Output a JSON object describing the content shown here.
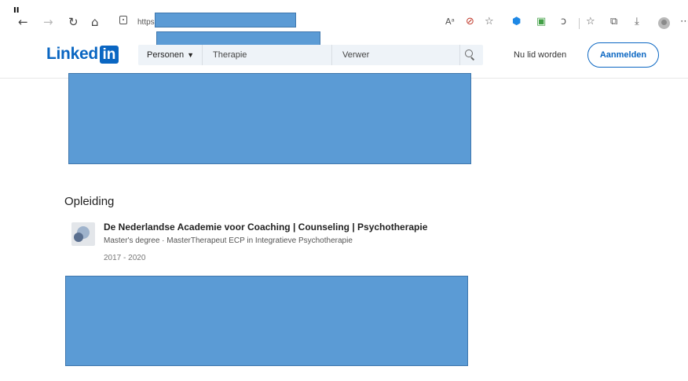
{
  "browser": {
    "pause_glyph": "II",
    "nav": {
      "back": "←",
      "forward": "→",
      "reload": "↻",
      "home": "⌂"
    },
    "url_prefix": "https:",
    "toolbar_icons": [
      "read-aloud-icon",
      "tracking-prevention-icon",
      "favorites-add-icon",
      "extension-shield-icon",
      "extension-monitor-icon",
      "copilot-icon",
      "favorites-icon",
      "collections-icon",
      "downloads-icon",
      "profile-icon",
      "more-icon"
    ],
    "toolbar_glyphs": {
      "read_aloud": "Aᵃ",
      "tracking": "⊘",
      "fav_add": "☆",
      "ext_shield": "⬢",
      "ext_monitor": "▣",
      "copilot": "ↄ",
      "favorites": "☆",
      "collections": "⧉",
      "downloads": "⤓",
      "more": "⋯"
    },
    "colors": {
      "redaction": "#5b9bd5"
    }
  },
  "linkedin": {
    "logo": {
      "word": "Linked",
      "box": "in"
    },
    "search": {
      "category": "Personen",
      "first_field": "Therapie",
      "second_field": "Verwer"
    },
    "join_label": "Nu lid worden",
    "signin_label": "Aanmelden",
    "brand_color": "#0a66c2"
  },
  "education": {
    "section_title": "Opleiding",
    "items": [
      {
        "school": "De Nederlandse Academie voor Coaching | Counseling | Psychotherapie",
        "degree": "Master's degree · MasterTherapeut ECP in Integratieve Psychotherapie",
        "dates": "2017 - 2020"
      }
    ]
  }
}
